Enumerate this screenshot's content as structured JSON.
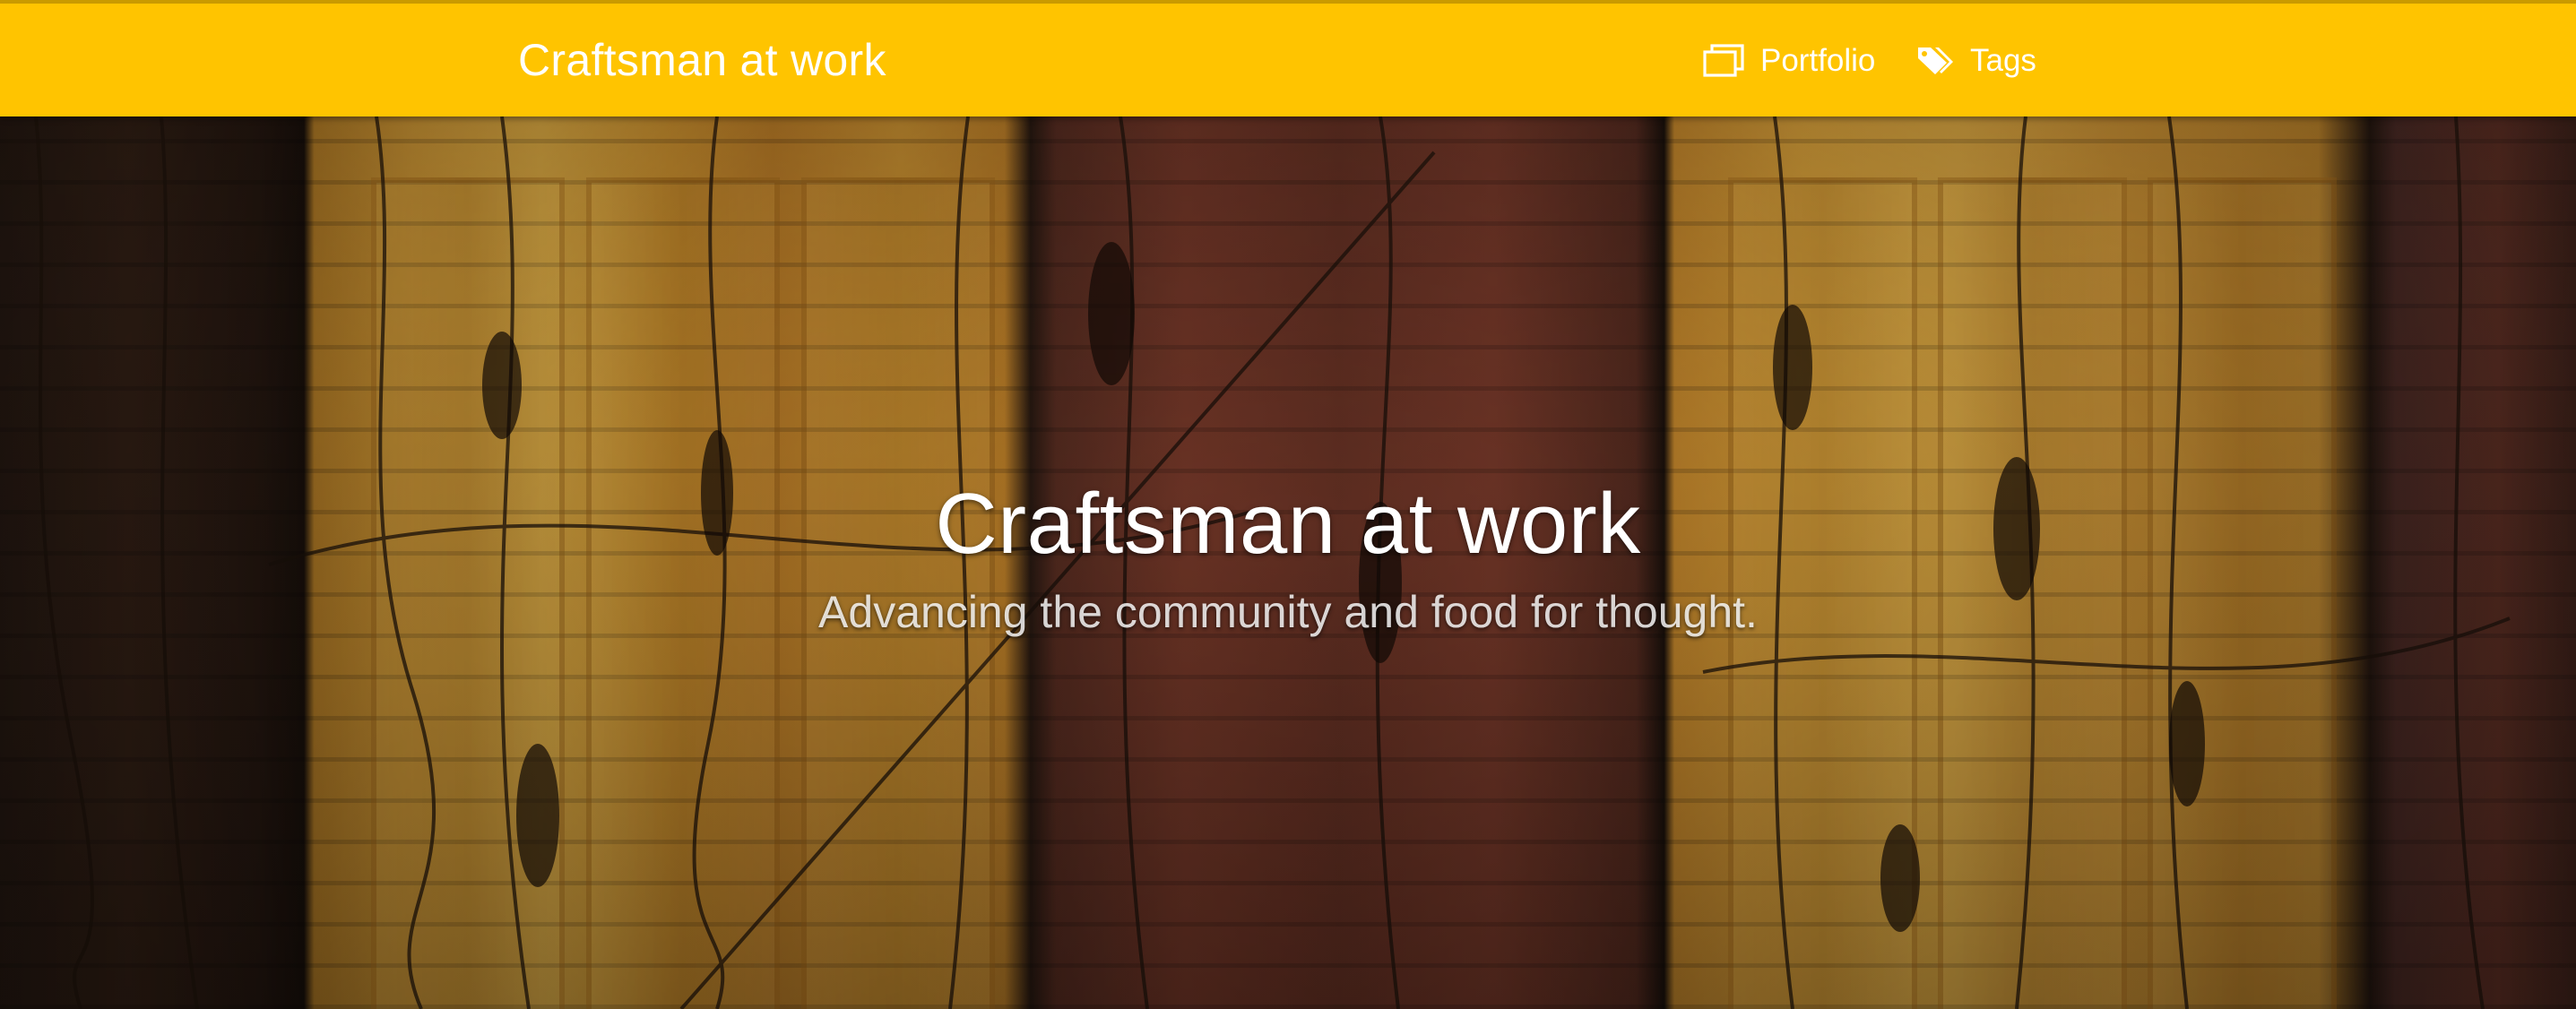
{
  "navbar": {
    "brand": "Craftsman at work",
    "links": [
      {
        "label": "Portfolio",
        "icon": "portfolio-icon"
      },
      {
        "label": "Tags",
        "icon": "tags-icon"
      }
    ],
    "background_color": "#ffc400",
    "text_color": "#ffffff"
  },
  "hero": {
    "title": "Craftsman at work",
    "subtitle": "Advancing the community and food for thought.",
    "background_image": "brick wall with wooden doors and dry vines"
  }
}
